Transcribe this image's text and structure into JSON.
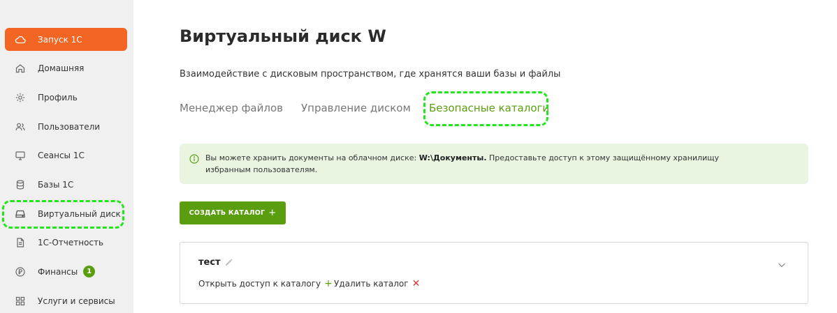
{
  "sidebar": {
    "items": [
      {
        "label": "Запуск 1С",
        "icon": "cloud-icon"
      },
      {
        "label": "Домашняя",
        "icon": "home-icon"
      },
      {
        "label": "Профиль",
        "icon": "gear-icon"
      },
      {
        "label": "Пользователи",
        "icon": "users-icon"
      },
      {
        "label": "Сеансы 1С",
        "icon": "monitor-icon"
      },
      {
        "label": "Базы 1С",
        "icon": "database-icon"
      },
      {
        "label": "Виртуальный диск",
        "icon": "hard-drive-icon"
      },
      {
        "label": "1С-Отчетность",
        "icon": "document-icon"
      },
      {
        "label": "Финансы",
        "icon": "coin-icon",
        "badge": "1"
      },
      {
        "label": "Услуги и сервисы",
        "icon": "grid-icon"
      }
    ],
    "active_index": 0
  },
  "main": {
    "title": "Виртуальный диск W",
    "subtitle": "Взаимодействие с дисковым пространством, где хранятся ваши базы и файлы",
    "tabs": [
      {
        "label": "Менеджер файлов"
      },
      {
        "label": "Управление диском"
      },
      {
        "label": "Безопасные каталоги"
      }
    ],
    "active_tab": 2,
    "info": {
      "text_before": "Вы можете хранить документы на облачном диске: ",
      "path": "W:\\Документы.",
      "text_after": " Предоставьте доступ к этому защищённому хранилищу избранным пользователям."
    },
    "create_button": {
      "label": "СОЗДАТЬ КАТАЛОГ",
      "icon": "+"
    },
    "catalogs": [
      {
        "name": "тест",
        "open_access_label": "Открыть доступ к каталогу",
        "open_access_icon": "+",
        "delete_label": "Удалить каталог",
        "delete_icon": "✕"
      }
    ]
  },
  "colors": {
    "accent_orange": "#f26522",
    "accent_green": "#5a9e0f",
    "info_bg": "#e9f5e1",
    "highlight": "#22e51c"
  }
}
